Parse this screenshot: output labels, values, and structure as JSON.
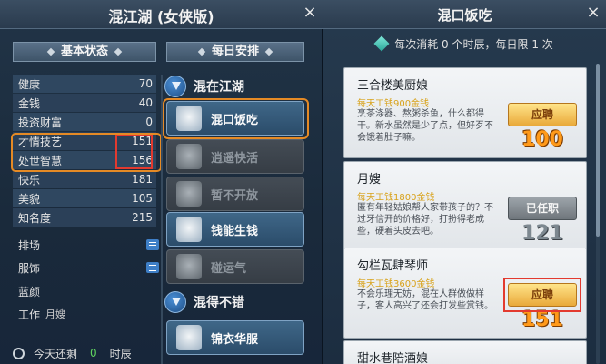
{
  "left_window": {
    "title": "混江湖 (女侠版)",
    "close_glyph": "×",
    "basic_status_header": "基本状态",
    "daily_schedule_header": "每日安排",
    "stats": [
      {
        "label": "健康",
        "value": "70"
      },
      {
        "label": "金钱",
        "value": "40"
      },
      {
        "label": "投资财富",
        "value": "0"
      },
      {
        "label": "才情技艺",
        "value": "151"
      },
      {
        "label": "处世智慧",
        "value": "156"
      },
      {
        "label": "快乐",
        "value": "181"
      },
      {
        "label": "美貌",
        "value": "105"
      },
      {
        "label": "知名度",
        "value": "215"
      }
    ],
    "extras": {
      "ranking": "排场",
      "clothing": "服饰",
      "partner": "蓝颜",
      "work_label": "工作",
      "work_value": "月嫂"
    },
    "bottom": {
      "prefix": "今天还剩",
      "count": "0",
      "suffix": "时辰"
    },
    "category1": "混在江湖",
    "category2": "混得不错",
    "buttons": [
      "混口饭吃",
      "逍遥快活",
      "暂不开放",
      "钱能生钱",
      "碰运气",
      "锦衣华服"
    ]
  },
  "right_window": {
    "title": "混口饭吃",
    "close_glyph": "×",
    "subtitle": "每次消耗 0 个时辰，每日限 1 次",
    "jobs": [
      {
        "name": "三合楼美厨娘",
        "wage": "每天工钱900金钱",
        "desc": "烹茶涤器、熬粥杀鱼，什么都得干。新水虽然是少了点，但好歹不会饿着肚子嘛。",
        "action": "应聘",
        "number": "100",
        "state": "hire"
      },
      {
        "name": "月嫂",
        "wage": "每天工钱1800金钱",
        "desc": "匿有年轻姑娘帮人家带孩子的？不过牙信开的价格好，打扮得老成些，硬着头皮去吧。",
        "action": "已任职",
        "number": "121",
        "state": "taken"
      },
      {
        "name": "勾栏瓦肆琴师",
        "wage": "每天工钱3600金钱",
        "desc": "不会乐理无妨，混在人群做做样子，客人高兴了还会打发些赏钱。",
        "action": "应聘",
        "number": "151",
        "state": "hire"
      },
      {
        "name": "甜水巷陪酒娘",
        "wage": "",
        "desc": "",
        "action": "",
        "number": "",
        "state": ""
      }
    ]
  }
}
